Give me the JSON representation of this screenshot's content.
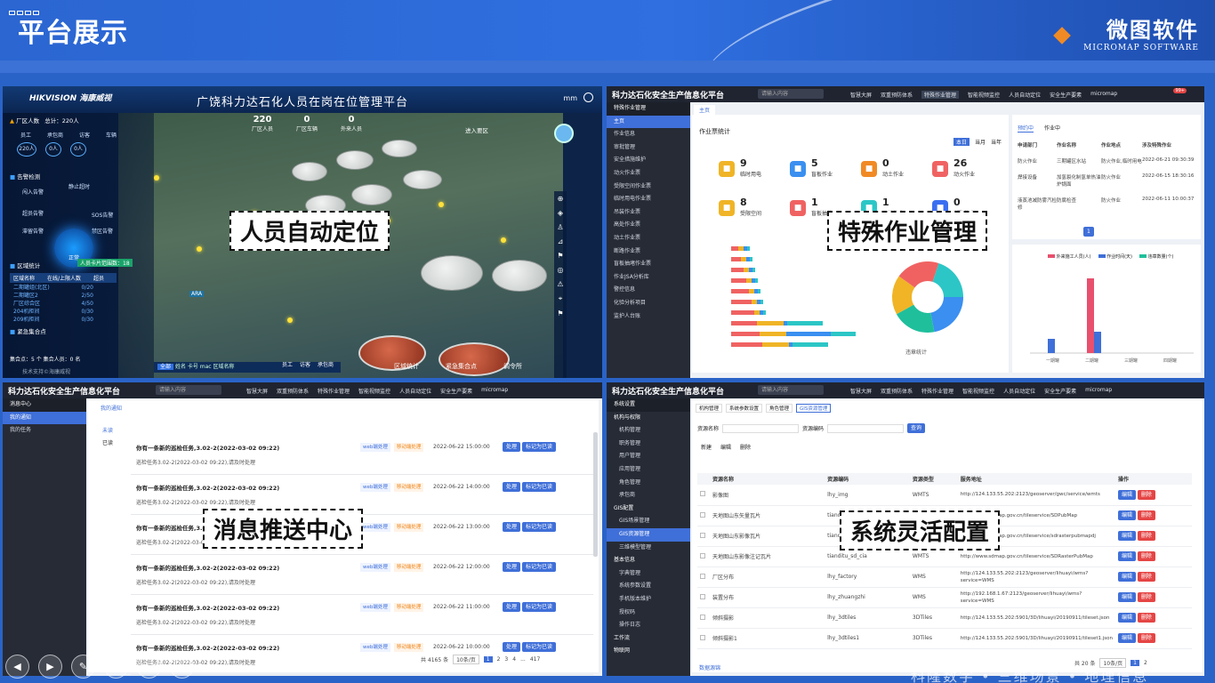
{
  "header": {
    "page_title": "平台展示",
    "brand_name": "微图软件",
    "brand_sub": "MICROMAP SOFTWARE"
  },
  "callouts": {
    "p1": "人员自动定位",
    "p2": "特殊作业管理",
    "p3": "消息推送中心",
    "p4": "系统灵活配置"
  },
  "panel1": {
    "logo": "HIKVISION 海康威视",
    "title": "广饶科力达石化人员在岗在位管理平台",
    "user": "mm",
    "factory_label": "厂区人数",
    "total_label": "总计：220人",
    "stats": [
      "员工",
      "承包商",
      "访客",
      "车辆"
    ],
    "stat_values": [
      "220人",
      "0人",
      "0人"
    ],
    "counts": [
      "220",
      "0",
      "0"
    ],
    "count_labels": [
      "厂区人员",
      "厂区车辆",
      "外来人员"
    ],
    "alarm_title": "告警检测",
    "alarm_items": [
      "闯入告警",
      "静止超时",
      "超员告警",
      "SOS告警",
      "滞留告警",
      "禁区告警"
    ],
    "gauge_text": "正常",
    "region_title": "区域统计",
    "region_badge": "人员卡片范围数：18",
    "region_cols": [
      "区域名称",
      "在线/上限人数",
      "超员"
    ],
    "regions": [
      [
        "二期罐组(北区)",
        "0/20"
      ],
      [
        "二期罐区2",
        "2/50"
      ],
      [
        "厂区综合区",
        "4/50"
      ],
      [
        "204机柜间",
        "0/30"
      ],
      [
        "209机柜间",
        "0/30"
      ]
    ],
    "assembly_title": "紧急集合点",
    "assembly_row": "集合点：5 个   集合人员：0 名",
    "footer": "技术支持©海康威视",
    "filter": "全部",
    "search_ph": "姓名 卡号 mac 区域名称",
    "legend": [
      "员工",
      "访客",
      "承包商"
    ],
    "bottom_tabs": [
      "区域统计",
      "紧急集合点",
      "调令所"
    ],
    "entry_btn": "进入要区"
  },
  "admin": {
    "title": "科力达石化安全生产信息化平台",
    "search_ph": "请输入内容",
    "nav": [
      "智慧大屏",
      "双重预防体系",
      "特殊作业管理",
      "智能视频监控",
      "人员自动定位",
      "安全生产要素",
      "micromap"
    ],
    "badge": "99+"
  },
  "panel2": {
    "side_title": "特殊作业管理",
    "breadcrumb": "主页",
    "menu": [
      "主页",
      "作业信息",
      "审批管理",
      "安全措施维护",
      "动火作业票",
      "受限空间作业票",
      "临时用电作业票",
      "吊装作业票",
      "高处作业票",
      "动土作业票",
      "断路作业票",
      "盲板抽堵作业票",
      "作业JSA分析库",
      "警控信息",
      "化验分析项目",
      "监护人台账"
    ],
    "stat_title": "作业票统计",
    "range": [
      "本日",
      "当月",
      "当年"
    ],
    "tiles": [
      {
        "num": "9",
        "label": "临时用电",
        "color": "#f0b426"
      },
      {
        "num": "5",
        "label": "盲板作业",
        "color": "#3a8ff0"
      },
      {
        "num": "0",
        "label": "动土作业",
        "color": "#f08a24"
      },
      {
        "num": "26",
        "label": "动火作业",
        "color": "#f06262"
      },
      {
        "num": "8",
        "label": "受限空间",
        "color": "#f0b426"
      },
      {
        "num": "1",
        "label": "盲板抽堵",
        "color": "#f06262"
      },
      {
        "num": "1",
        "label": "吊装作业",
        "color": "#2cc6c6"
      },
      {
        "num": "0",
        "label": "断路作业",
        "color": "#3a6ff0"
      }
    ],
    "tabs": [
      "预约中",
      "作业中"
    ],
    "table_cols": [
      "申请部门",
      "作业名称",
      "作业地点",
      "涉及特殊作业"
    ],
    "table_rows": [
      [
        "防火作业",
        "三期罐区水站",
        "防火作业,临时用电",
        "2022-06-21 09:30:39"
      ],
      [
        "焊接设备",
        "加氢裂化制氢单热油炉锅面",
        "防火作业",
        "2022-06-15 18:30:16"
      ],
      [
        "液蒸池减防雾汽检修",
        "防腐检查",
        "防火作业",
        "2022-06-11 10:00:37"
      ]
    ],
    "pager_page": "1",
    "donut_label": "违章统计",
    "bar_legend": [
      "外来施工人员(人)",
      "作业时间(天)",
      "违章数量(个)"
    ],
    "bar_x": [
      "一期罐",
      "二期罐",
      "三期罐",
      "四期罐"
    ]
  },
  "panel3": {
    "side_title": "消息中心",
    "menu": [
      "我的通知",
      "我的任务"
    ],
    "breadcrumb": "我的通知",
    "filters": [
      "未读",
      "已读"
    ],
    "msg_title": "你有一条新的巡检任务,3.02-2(2022-03-02 09:22)",
    "msg_body": "巡检任务3.02-2(2022-03-02 09:22),请及时处理",
    "tag_web": "web端处理",
    "tag_mobile": "移动端处理",
    "times": [
      "2022-06-22 15:00:00",
      "2022-06-22 14:00:00",
      "2022-06-22 13:00:00",
      "2022-06-22 12:00:00",
      "2022-06-22 11:00:00",
      "2022-06-22 10:00:00"
    ],
    "btn_handle": "处理",
    "btn_read": "标记为已读",
    "total": "共 4165 条",
    "per_page": "10条/页",
    "pages": [
      "1",
      "2",
      "3",
      "4",
      "...",
      "417"
    ]
  },
  "panel4": {
    "side_title": "系统设置",
    "menu": [
      "机构与权限",
      "机构管理",
      "职务管理",
      "用户管理",
      "应用管理",
      "角色管理",
      "承包商",
      "GIS配置",
      "GIS场景管理",
      "GIS资源管理",
      "三维模型管理",
      "基本信息",
      "字典管理",
      "系统参数设置",
      "手机版本维护",
      "授权码",
      "操作日志",
      "工作流",
      "物联网"
    ],
    "tabs": [
      "机构管理",
      "系统参数设置",
      "角色管理",
      "GIS资源管理"
    ],
    "f_name": "资源名称",
    "f_code": "资源编码",
    "btn_search": "查询",
    "btn_new": "新建",
    "btn_edit": "编辑",
    "btn_del": "删除",
    "cols": [
      "资源名称",
      "资源编码",
      "资源类型",
      "服务地址",
      "操作"
    ],
    "rows": [
      [
        "影像图",
        "lhy_img",
        "WMTS",
        "http://124.133.55.202:2123/geoserver/gwc/service/wmts"
      ],
      [
        "天地图山东矢量瓦片",
        "tianditu_sd_vec",
        "WMTS",
        "http://www.sdmap.gov.cn/tileservice/SDPubMap"
      ],
      [
        "天地图山东影像瓦片",
        "tianditu_sd_img",
        "WMTS",
        "http://www.sdmap.gov.cn/tileservice/sdrasterpubmapdj"
      ],
      [
        "天地图山东影像注记瓦片",
        "tianditu_sd_cia",
        "WMTS",
        "http://www.sdmap.gov.cn/tileservice/SDRasterPubMap"
      ],
      [
        "厂区分布",
        "lhy_factory",
        "WMS",
        "http://124.133.55.202:2123/geoserver/lihuayi/wms?service=WMS"
      ],
      [
        "装置分布",
        "lhy_zhuangzhi",
        "WMS",
        "http://192.168.1.67:2123/geoserver/lihuayi/wms?service=WMS"
      ],
      [
        "倾斜摄影",
        "lhy_3dtiles",
        "3DTiles",
        "http://124.133.55.202:5901/3D/lihuayi/20190911/tileset.json"
      ],
      [
        "倾斜摄影1",
        "lhy_3dtiles1",
        "3DTiles",
        "http://124.133.55.202:5901/3D/lihuayi/20190911/tileset1.json"
      ]
    ],
    "total": "共 20 条",
    "per_page": "10条/页",
    "pages": [
      "1",
      "2"
    ],
    "footer_link": "数据源锦"
  },
  "toolbar_icons": [
    "prev-icon",
    "next-icon",
    "pen-icon",
    "grid-icon",
    "zoom-icon",
    "more-icon"
  ],
  "footer_ticker": "科隆数字 • 三维场景 • 地理信息"
}
